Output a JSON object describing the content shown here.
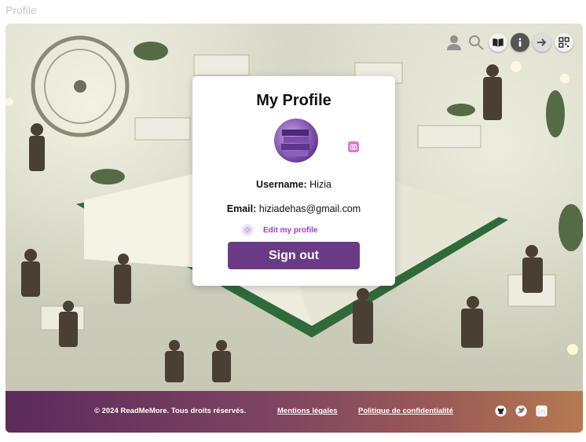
{
  "tab_title": "Profile",
  "card": {
    "title": "My Profile",
    "username_label": "Username:",
    "username_value": "Hizia",
    "email_label": "Email:",
    "email_value": "hiziadehas@gmail.com",
    "edit_label": "Edit my profile",
    "signout_label": "Sign out"
  },
  "footer": {
    "copyright": "© 2024 ReadMeMore. Tous droits réservés.",
    "legal_link": "Mentions légales",
    "privacy_link": "Politique de confidentialité"
  },
  "colors": {
    "primary": "#6a3a86",
    "accent": "#9a3fc2",
    "footer_start": "#5b2b5c",
    "footer_end": "#b57a4f"
  },
  "icons": {
    "top": [
      "user-icon",
      "search-icon",
      "book-icon",
      "info-icon",
      "arrow-right-icon",
      "qr-code-icon"
    ],
    "social": [
      "github-icon",
      "twitter-icon",
      "linkedin-icon"
    ]
  }
}
